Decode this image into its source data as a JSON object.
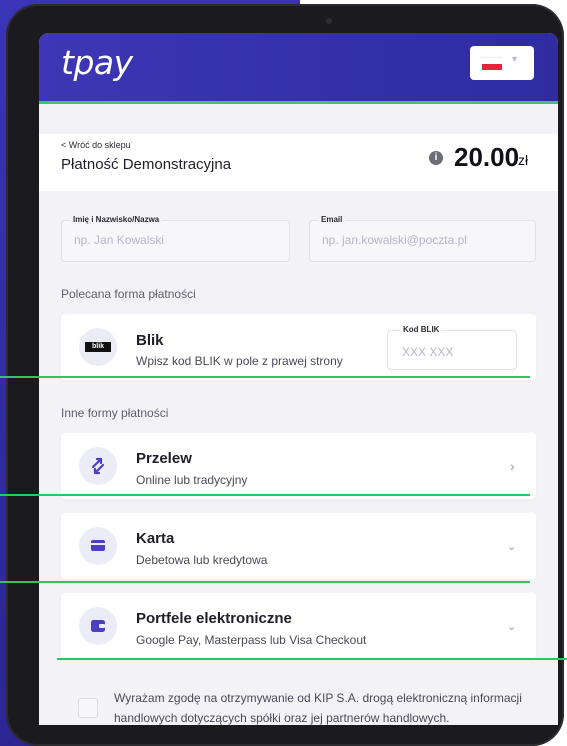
{
  "header": {
    "logo": "tpay",
    "language": {
      "flag": "PL",
      "chevron_icon": "chevron-down-icon"
    }
  },
  "merchant": {
    "back_label": "< Wróć do sklepu",
    "name": "Płatność Demonstracyjna",
    "info_icon": "info-icon",
    "amount": "20.00",
    "currency": "zł"
  },
  "form": {
    "name_label": "Imię i Nazwisko/Nazwa",
    "name_placeholder": "np. Jan Kowalski",
    "email_label": "Email",
    "email_placeholder": "np. jan.kowalski@poczta.pl"
  },
  "recommended": {
    "section_label": "Polecana forma płatności",
    "blik": {
      "logo_text": "blik",
      "title": "Blik",
      "subtitle": "Wpisz kod BLIK w pole z prawej strony",
      "code_label": "Kod BLIK",
      "code_placeholder": "XXX XXX"
    }
  },
  "other": {
    "section_label": "Inne formy płatności",
    "methods": [
      {
        "title": "Przelew",
        "subtitle": "Online lub tradycyjny",
        "icon": "transfer-arrows-icon",
        "chevron": "chevron-right-icon"
      },
      {
        "title": "Karta",
        "subtitle": "Debetowa lub kredytowa",
        "icon": "credit-card-icon",
        "chevron": "chevron-down-icon"
      },
      {
        "title": "Portfele elektroniczne",
        "subtitle": "Google Pay, Masterpass lub Visa Checkout",
        "icon": "wallet-icon",
        "chevron": "chevron-down-icon"
      }
    ]
  },
  "consent": {
    "text": "Wyrażam zgodę na otrzymywanie od KIP S.A. drogą elektroniczną informacji handlowych dotyczących spółki oraz jej partnerów handlowych."
  },
  "colors": {
    "brand": "#3d36b6",
    "accent_green": "#2ec65f",
    "background": "#f3f3f7"
  }
}
